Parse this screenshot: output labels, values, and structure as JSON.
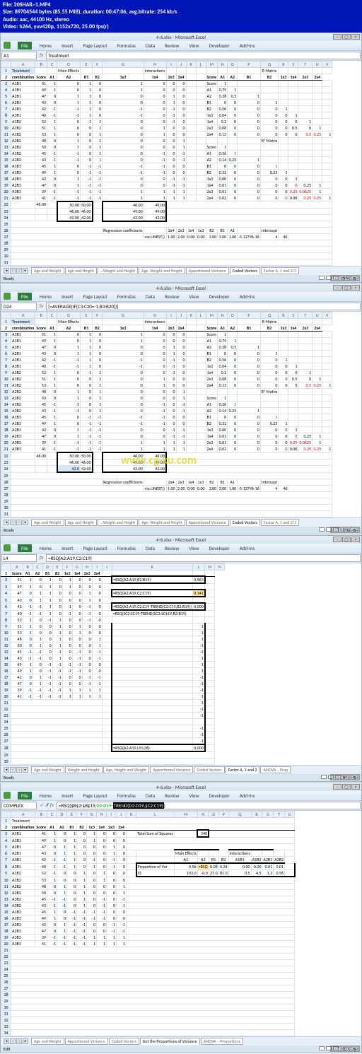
{
  "file_info": {
    "l1": "File: 20SHAR~1.MP4",
    "l2": "Size: 89704544 bytes (85.55 MiB), duration: 00:47:06, avg.bitrate: 254 kb/s",
    "l3": "Audio: aac, 44100 Hz, stereo",
    "l4": "Video: h264, yuv420p, 1152x720, 25.00 fps(r)"
  },
  "title": "4-6.xlsx - Microsoft Excel",
  "ribbon": [
    "File",
    "Home",
    "Insert",
    "Page Layout",
    "Formulas",
    "Data",
    "Review",
    "View",
    "Developer",
    "Add-Ins"
  ],
  "w1": {
    "name_box": "A1",
    "formula": "Treatment",
    "sheet_tabs": [
      "Age and Weight",
      "Age and Height",
      "...Weight and Height",
      "Age, Weight and Height",
      "Apportioned Variance",
      "Coded Vectors",
      "Factor A, 1 and 2/3"
    ],
    "active_tab": 5,
    "timecode": "00:05:52:470",
    "cols": [
      "",
      "A",
      "B",
      "C",
      "D",
      "E",
      "F",
      "G",
      "H",
      "I",
      "J",
      "K",
      "L",
      "M",
      "N",
      "O",
      "P",
      "Q",
      "R",
      "S",
      "T",
      "U",
      "V"
    ],
    "sec_hdr": {
      "treatment": "Treatment",
      "combo": "combination",
      "score": "Score",
      "main": "Main Effects",
      "inter": "Interactions",
      "rmat": "R Matrix",
      "r2mat": "R² Matrix"
    },
    "factors": [
      "A1",
      "A2",
      "B1",
      "B2",
      "1x3",
      "1x4",
      "2x3",
      "2x4"
    ],
    "rows": [
      [
        "A1B1",
        "51",
        "1",
        "0",
        "1",
        "0",
        "1",
        "0",
        "0",
        "0"
      ],
      [
        "A1B1",
        "49",
        "1",
        "0",
        "1",
        "0",
        "1",
        "0",
        "0",
        "0"
      ],
      [
        "A2B1",
        "47",
        "0",
        "1",
        "1",
        "0",
        "0",
        "0",
        "1",
        "0"
      ],
      [
        "A2B1",
        "43",
        "0",
        "1",
        "1",
        "0",
        "0",
        "0",
        "1",
        "0"
      ],
      [
        "A1B1",
        "42",
        "-1",
        "-1",
        "1",
        "0",
        "-1",
        "0",
        "-1",
        "0"
      ],
      [
        "A3B1",
        "40",
        "-1",
        "-1",
        "1",
        "0",
        "-1",
        "0",
        "-1",
        "0"
      ],
      [
        "A1B2",
        "52",
        "1",
        "0",
        "-1",
        "1",
        "0",
        "0",
        "-1",
        "0"
      ],
      [
        "A1B2",
        "51",
        "1",
        "0",
        "0",
        "1",
        "0",
        "1",
        "0",
        "0"
      ],
      [
        "A1B2",
        "53",
        "1",
        "0",
        "0",
        "1",
        "0",
        "1",
        "0",
        "0"
      ],
      [
        "A2B2",
        "48",
        "0",
        "1",
        "0",
        "1",
        "0",
        "0",
        "0",
        "1"
      ],
      [
        "A2B2",
        "50",
        "0",
        "1",
        "0",
        "1",
        "0",
        "0",
        "0",
        "1"
      ],
      [
        "A1B2",
        "45",
        "-1",
        "-1",
        "0",
        "1",
        "0",
        "-1",
        "0",
        "-1"
      ],
      [
        "A3B2",
        "43",
        "-1",
        "-1",
        "0",
        "1",
        "0",
        "-1",
        "0",
        "-1"
      ],
      [
        "A1B3",
        "45",
        "1",
        "0",
        "-1",
        "-1",
        "-1",
        "-1",
        "0",
        "0"
      ],
      [
        "A1B3",
        "49",
        "1",
        "0",
        "-1",
        "-1",
        "-1",
        "-1",
        "0",
        "0"
      ],
      [
        "A2B3",
        "42",
        "0",
        "1",
        "-1",
        "-1",
        "0",
        "0",
        "-1",
        "-1"
      ],
      [
        "A2B3",
        "47",
        "0",
        "1",
        "-1",
        "-1",
        "0",
        "0",
        "-1",
        "-1"
      ],
      [
        "A3B3",
        "39",
        "-1",
        "-1",
        "-1",
        "-1",
        "1",
        "1",
        "1",
        "1"
      ],
      [
        "A3B3",
        "41",
        "-1",
        "-1",
        "-1",
        "-1",
        "1",
        "1",
        "1",
        "1"
      ]
    ],
    "avg": "46.00",
    "box1": [
      [
        "50.00",
        "50.00"
      ],
      [
        "46.00",
        "46.00"
      ],
      [
        "42.00",
        "42.00"
      ]
    ],
    "box2": [
      [
        "46.00",
        "46.00"
      ],
      [
        "49.00",
        "49.00"
      ],
      [
        "43.00",
        "43.00"
      ]
    ],
    "rmat_hdr": [
      "Score",
      "A1",
      "A2",
      "B1",
      "B2",
      "1x3",
      "1x4",
      "2x3",
      "2x4"
    ],
    "rmat_rows": [
      [
        "Score",
        "1",
        "",
        "",
        "",
        "",
        "",
        "",
        "",
        ""
      ],
      [
        "A1",
        "0.79",
        "1",
        "",
        "",
        "",
        "",
        "",
        "",
        ""
      ],
      [
        "A2",
        "0.38",
        "0.5",
        "1",
        "",
        "",
        "",
        "",
        "",
        ""
      ],
      [
        "B1",
        "0",
        "0",
        "0",
        "1",
        "",
        "",
        "",
        "",
        ""
      ],
      [
        "B2",
        "0.56",
        "0",
        "0",
        "0",
        "1",
        "",
        "",
        "",
        ""
      ],
      [
        "1x3",
        "0.04",
        "0",
        "0",
        "0",
        "0",
        "1",
        "",
        "",
        ""
      ],
      [
        "1x4",
        "0.2",
        "0",
        "0",
        "0",
        "0",
        "0",
        "1",
        "",
        ""
      ],
      [
        "2x3",
        "0.08",
        "0",
        "0",
        "0",
        "0",
        "0.5",
        "0",
        "1",
        ""
      ],
      [
        "2x4",
        "0.13",
        "0",
        "0",
        "0",
        "0",
        "0",
        "0.5",
        "0.25",
        "1"
      ]
    ],
    "r2mat_rows": [
      [
        "Score",
        "1",
        "",
        "",
        "",
        "",
        "",
        "",
        "",
        ""
      ],
      [
        "A1",
        "0.56",
        "1",
        "",
        "",
        "",
        "",
        "",
        "",
        ""
      ],
      [
        "A2",
        "0.14",
        "0.25",
        "1",
        "",
        "",
        "",
        "",
        "",
        ""
      ],
      [
        "B1",
        "0",
        "0",
        "0",
        "1",
        "",
        "",
        "",
        "",
        ""
      ],
      [
        "B2",
        "0.32",
        "0",
        "0",
        "0.25",
        "1",
        "",
        "",
        "",
        ""
      ],
      [
        "1x3",
        "0.00",
        "0",
        "0",
        "0",
        "0",
        "1",
        "",
        "",
        ""
      ],
      [
        "1x4",
        "0.01",
        "0",
        "0",
        "0",
        "0",
        "0",
        "0.25",
        "1",
        ""
      ],
      [
        "2x3",
        "0.01",
        "0",
        "0",
        "0",
        "0",
        "0.25",
        "0.0625",
        "1",
        ""
      ],
      [
        "2x4",
        "0.02",
        "0",
        "0",
        "0",
        "0",
        "0.06",
        "0.25",
        "0.25",
        "1"
      ]
    ],
    "reg_lbl": "Regression coefficients",
    "via": "via LINEST()",
    "reg_hdr": [
      "2x4",
      "2x3",
      "1x4",
      "1x3",
      "B2",
      "B1",
      "A1",
      "",
      "Intercept"
    ],
    "reg_vals": [
      "1.00",
      "2.00",
      "0.00",
      "0.00",
      "3.00",
      "3.00",
      "1.00",
      "-5.12796-16",
      "4",
      "46"
    ]
  },
  "w2": {
    "name_box": "D24",
    "formula": "{=AVERAGE(IF(C3:C20=-1,B3:B20))}",
    "box1_sel": "42.0",
    "timecode": "00:18:07:870",
    "watermark": "www.cg-ku.com"
  },
  "w3": {
    "name_box": "L4",
    "formula": "=RSQ(A2:A19,C2:C19)",
    "timecode": "00:24:28:370",
    "cols": [
      "",
      "A",
      "B",
      "C",
      "D",
      "E",
      "F",
      "G",
      "H",
      "I",
      "J",
      "K",
      "L",
      "M",
      "N"
    ],
    "hdr": [
      "Score",
      "A1",
      "A2",
      "B1",
      "B2",
      "1x3",
      "1x4",
      "2x3",
      "2x4"
    ],
    "rows": [
      [
        "51",
        "1",
        "0",
        "1",
        "0",
        "1",
        "0",
        "0",
        "0"
      ],
      [
        "49",
        "1",
        "0",
        "1",
        "0",
        "1",
        "0",
        "0",
        "0"
      ],
      [
        "47",
        "0",
        "1",
        "1",
        "0",
        "0",
        "0",
        "1",
        "0"
      ],
      [
        "43",
        "0",
        "1",
        "1",
        "0",
        "0",
        "0",
        "1",
        "0"
      ],
      [
        "42",
        "-1",
        "-1",
        "1",
        "0",
        "-1",
        "0",
        "-1",
        "0"
      ],
      [
        "40",
        "-1",
        "-1",
        "1",
        "0",
        "-1",
        "0",
        "-1",
        "0"
      ],
      [
        "52",
        "1",
        "0",
        "-1",
        "1",
        "0",
        "0",
        "-1",
        "0"
      ],
      [
        "51",
        "1",
        "0",
        "0",
        "1",
        "0",
        "1",
        "0",
        "0"
      ],
      [
        "53",
        "1",
        "0",
        "0",
        "1",
        "0",
        "1",
        "0",
        "0"
      ],
      [
        "48",
        "0",
        "1",
        "0",
        "1",
        "0",
        "0",
        "0",
        "1"
      ],
      [
        "50",
        "0",
        "1",
        "0",
        "1",
        "0",
        "0",
        "0",
        "1"
      ],
      [
        "45",
        "-1",
        "-1",
        "0",
        "1",
        "0",
        "-1",
        "0",
        "-1"
      ],
      [
        "43",
        "-1",
        "-1",
        "0",
        "1",
        "0",
        "-1",
        "0",
        "-1"
      ],
      [
        "45",
        "1",
        "0",
        "-1",
        "-1",
        "-1",
        "-1",
        "0",
        "0"
      ],
      [
        "49",
        "1",
        "0",
        "-1",
        "-1",
        "-1",
        "-1",
        "0",
        "0"
      ],
      [
        "42",
        "0",
        "1",
        "-1",
        "-1",
        "0",
        "0",
        "-1",
        "-1"
      ],
      [
        "47",
        "0",
        "1",
        "-1",
        "-1",
        "0",
        "0",
        "-1",
        "-1"
      ],
      [
        "39",
        "-1",
        "-1",
        "-1",
        "-1",
        "1",
        "1",
        "1",
        "1"
      ],
      [
        "41",
        "-1",
        "-1",
        "-1",
        "-1",
        "1",
        "1",
        "1",
        "1"
      ]
    ],
    "f1": "=RSQ(A2:A19,B2:B19)",
    "v1": "0.563",
    "f2": "=RSQ(A2:A19,C2:C19)",
    "v2": "0.141",
    "f3": "=RSQ(A2:A19,C2:C19-TREND(C2:C19,B2:B19))",
    "v3": "0.000",
    "f4": "=RSQ(SC2:SC19-TREND(SC2:SC$19,B2:B19)",
    "f5": "=RSQ(A2:A19,L9:L26)",
    "v5": "0.000",
    "resid": [
      "1",
      "1",
      "1",
      "-1",
      "-1",
      "1",
      "1",
      "1",
      "-1",
      "-1",
      "-1",
      "1",
      "1",
      "-1",
      "-1",
      "",
      "-1",
      "-1",
      "1"
    ],
    "sheet_tabs": [
      "Age and Weight",
      "Weight and Height",
      "Age, Height and Weight",
      "Apportioned Variance",
      "Coded Vectors",
      "Factor A, 1 and 2",
      "ANOVA – Prop"
    ],
    "active_tab": 5
  },
  "w4": {
    "name_box": "COMPLEX",
    "formula_pre": "=RSQ($B$2:$B$19,",
    "formula_mid": "D2:D19-",
    "formula_hl": "TREND(D2:D19,$C2:C19)",
    "timecode": "00:40:40:470",
    "cols": [
      "",
      "A",
      "B",
      "C",
      "D",
      "E",
      "F",
      "G",
      "H",
      "I",
      "J",
      "K",
      "L",
      "M",
      "N",
      "O",
      "P",
      "Q",
      "R",
      "S",
      "T",
      "U"
    ],
    "hdr_main": "Main Effects",
    "hdr_inter": "Interactions",
    "hdr2": [
      "Treatment",
      "",
      "",
      "",
      "",
      "",
      "",
      "",
      "",
      "",
      ""
    ],
    "hdr3": [
      "combination",
      "Score",
      "A1",
      "A2",
      "B1",
      "B2",
      "1x3",
      "1x4",
      "2x3",
      "2x4"
    ],
    "tss_lbl": "Total Sum of Squares",
    "tss": "340",
    "pv_lbl": "Proportion of Var",
    "ss_lbl": "SS",
    "pv_hdr": [
      "A1",
      "A2",
      "B1",
      "B2",
      "A1B1",
      "A1B2",
      "A2B1",
      "A2B2"
    ],
    "pv_vals": [
      "0.56",
      "=RSQ",
      "0.08",
      "0.24",
      "0.00",
      "0.00",
      "0.01",
      "0.01"
    ],
    "ss_vals": [
      "192.0",
      "-0.0",
      "27.0",
      "81.0",
      "0.5",
      "4.5",
      "1.3",
      "0.56"
    ],
    "rows": [
      [
        "A1B1",
        "41",
        "1",
        "0",
        "1",
        "0",
        "1",
        "0",
        "0",
        "0"
      ],
      [
        "A1B1",
        "49",
        "1",
        "0",
        "1",
        "0",
        "1",
        "0",
        "0",
        "0"
      ],
      [
        "A2B1",
        "47",
        "0",
        "1",
        "1",
        "0",
        "0",
        "0",
        "1",
        "0"
      ],
      [
        "A2B1",
        "43",
        "0",
        "1",
        "1",
        "0",
        "0",
        "0",
        "1",
        "0"
      ],
      [
        "A3B1",
        "42",
        "-1",
        "-1",
        "1",
        "0",
        "-1",
        "0",
        "-1",
        "0"
      ],
      [
        "A3B1",
        "40",
        "-1",
        "-1",
        "1",
        "0",
        "-1",
        "0",
        "-1",
        "0"
      ],
      [
        "A1B2",
        "52",
        "-1",
        "0",
        "0",
        "1",
        "0",
        "1",
        "0",
        "0"
      ],
      [
        "A1B2",
        "53",
        "1",
        "0",
        "0",
        "1",
        "0",
        "1",
        "0",
        "0"
      ],
      [
        "A2B2",
        "48",
        "0",
        "1",
        "0",
        "1",
        "0",
        "0",
        "0",
        "1"
      ],
      [
        "A2B2",
        "50",
        "0",
        "1",
        "0",
        "1",
        "0",
        "0",
        "0",
        "1"
      ],
      [
        "A3B2",
        "45",
        "-1",
        "-1",
        "0",
        "1",
        "0",
        "-1",
        "0",
        "-1"
      ],
      [
        "A3B2",
        "43",
        "-1",
        "-1",
        "0",
        "1",
        "0",
        "-1",
        "0",
        "-1"
      ],
      [
        "A1B3",
        "45",
        "1",
        "0",
        "-1",
        "-1",
        "-1",
        "-1",
        "0",
        "0"
      ],
      [
        "A1B3",
        "49",
        "1",
        "0",
        "-1",
        "-1",
        "-1",
        "-1",
        "0",
        "0"
      ],
      [
        "A2B3",
        "42",
        "0",
        "1",
        "-1",
        "-1",
        "0",
        "0",
        "-1",
        "-1"
      ],
      [
        "A2B3",
        "47",
        "0",
        "1",
        "-1",
        "-1",
        "0",
        "0",
        "-1",
        "-1"
      ],
      [
        "A3B3",
        "39",
        "-1",
        "-1",
        "-1",
        "-1",
        "1",
        "1",
        "1",
        "1"
      ],
      [
        "A3B3",
        "41",
        "-1",
        "-1",
        "-1",
        "-1",
        "1",
        "1",
        "1",
        "1"
      ]
    ],
    "sheet_tabs": [
      "Age and Weight",
      "Apportioned Variance",
      "Coded Vectors",
      "Get the Proportions of Variance",
      "ANOVA – Proportions"
    ],
    "active_tab": 3
  },
  "status": "Ready"
}
